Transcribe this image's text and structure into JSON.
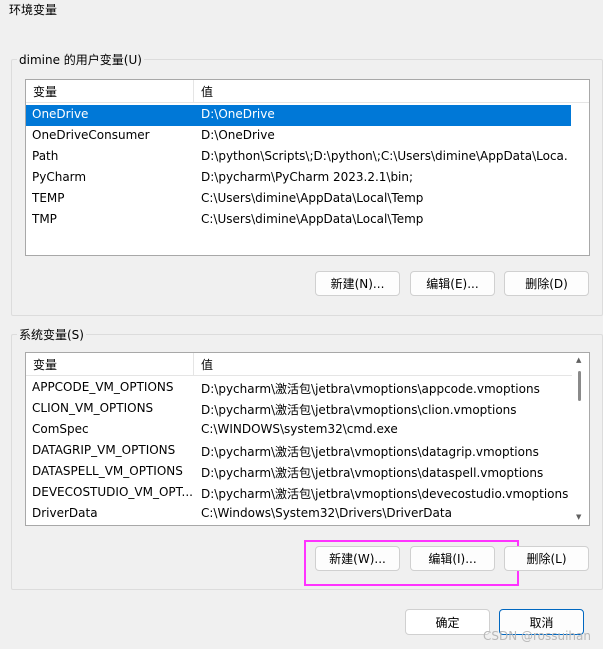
{
  "window": {
    "title": "环境变量"
  },
  "user_vars": {
    "group_label": "dimine 的用户变量(U)",
    "columns": [
      "变量",
      "值"
    ],
    "rows": [
      {
        "name": "OneDrive",
        "value": "D:\\OneDrive"
      },
      {
        "name": "OneDriveConsumer",
        "value": "D:\\OneDrive"
      },
      {
        "name": "Path",
        "value": "D:\\python\\Scripts\\;D:\\python\\;C:\\Users\\dimine\\AppData\\Loca..."
      },
      {
        "name": "PyCharm",
        "value": "D:\\pycharm\\PyCharm 2023.2.1\\bin;"
      },
      {
        "name": "TEMP",
        "value": "C:\\Users\\dimine\\AppData\\Local\\Temp"
      },
      {
        "name": "TMP",
        "value": "C:\\Users\\dimine\\AppData\\Local\\Temp"
      }
    ],
    "selected_row": "OneDrive",
    "buttons": {
      "new": "新建(N)...",
      "edit": "编辑(E)...",
      "delete": "删除(D)"
    }
  },
  "system_vars": {
    "group_label": "系统变量(S)",
    "columns": [
      "变量",
      "值"
    ],
    "rows": [
      {
        "name": "APPCODE_VM_OPTIONS",
        "value": "D:\\pycharm\\激活包\\jetbra\\vmoptions\\appcode.vmoptions"
      },
      {
        "name": "CLION_VM_OPTIONS",
        "value": "D:\\pycharm\\激活包\\jetbra\\vmoptions\\clion.vmoptions"
      },
      {
        "name": "ComSpec",
        "value": "C:\\WINDOWS\\system32\\cmd.exe"
      },
      {
        "name": "DATAGRIP_VM_OPTIONS",
        "value": "D:\\pycharm\\激活包\\jetbra\\vmoptions\\datagrip.vmoptions"
      },
      {
        "name": "DATASPELL_VM_OPTIONS",
        "value": "D:\\pycharm\\激活包\\jetbra\\vmoptions\\dataspell.vmoptions"
      },
      {
        "name": "DEVECOSTUDIO_VM_OPT...",
        "value": "D:\\pycharm\\激活包\\jetbra\\vmoptions\\devecostudio.vmoptions"
      },
      {
        "name": "DriverData",
        "value": "C:\\Windows\\System32\\Drivers\\DriverData"
      }
    ],
    "buttons": {
      "new": "新建(W)...",
      "edit": "编辑(I)...",
      "delete": "删除(L)"
    }
  },
  "footer": {
    "ok": "确定",
    "cancel": "取消"
  },
  "watermark": "CSDN @rossuihan",
  "colors": {
    "selection": "#0078d7",
    "highlight_box": "#ff33ff",
    "primary_border": "#0067c0"
  }
}
